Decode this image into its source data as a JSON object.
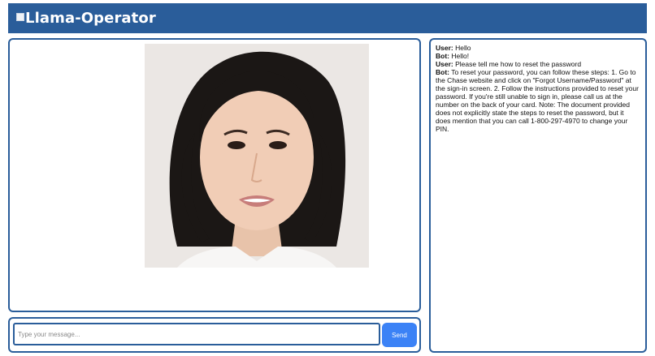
{
  "header": {
    "title": "Llama-Operator",
    "logo_icon": "broken-image-icon",
    "background": "#2a5d9a"
  },
  "video": {
    "avatar_icon": "avatar-face-icon"
  },
  "composer": {
    "placeholder": "Type your message...",
    "send_label": "Send",
    "accent": "#3b82f6"
  },
  "chat": {
    "messages": [
      {
        "speaker": "User:",
        "text": "Hello"
      },
      {
        "speaker": "Bot:",
        "text": "Hello!"
      },
      {
        "speaker": "User:",
        "text": "Please tell me how to reset the password"
      },
      {
        "speaker": "Bot:",
        "text": "To reset your password, you can follow these steps: 1. Go to the Chase website and click on \"Forgot Username/Password\" at the sign-in screen. 2. Follow the instructions provided to reset your password. If you're still unable to sign in, please call us at the number on the back of your card. Note: The document provided does not explicitly state the steps to reset the password, but it does mention that you can call 1-800-297-4970 to change your PIN."
      }
    ]
  }
}
